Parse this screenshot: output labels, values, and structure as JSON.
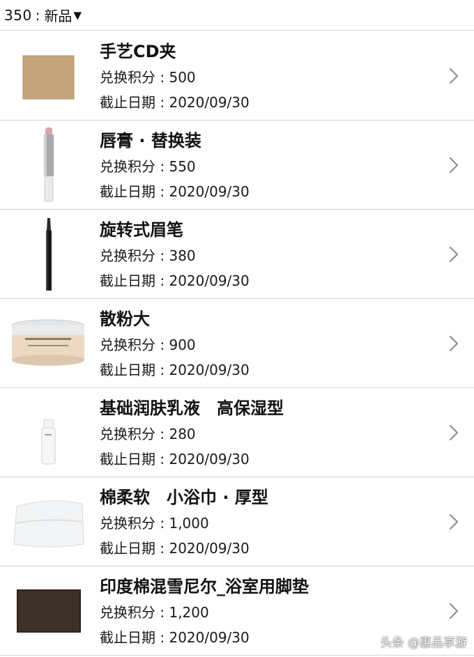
{
  "header": {
    "points": "350",
    "separator": ":",
    "filter_label": "新品",
    "caret": "▼"
  },
  "labels": {
    "points": "兑换积分",
    "deadline": "截止日期",
    "colon": ":"
  },
  "items": [
    {
      "name": "手艺CD夹",
      "points": "500",
      "deadline": "2020/09/30",
      "thumb": "cd-holder-image"
    },
    {
      "name": "唇膏 · 替换装",
      "points": "550",
      "deadline": "2020/09/30",
      "thumb": "lipstick-image"
    },
    {
      "name": "旋转式眉笔",
      "points": "380",
      "deadline": "2020/09/30",
      "thumb": "eyebrow-pencil-image"
    },
    {
      "name": "散粉大",
      "points": "900",
      "deadline": "2020/09/30",
      "thumb": "loose-powder-image"
    },
    {
      "name": "基础润肤乳液　高保湿型",
      "points": "280",
      "deadline": "2020/09/30",
      "thumb": "lotion-bottle-image"
    },
    {
      "name": "棉柔软　小浴巾 · 厚型",
      "points": "1,000",
      "deadline": "2020/09/30",
      "thumb": "towel-image"
    },
    {
      "name": "印度棉混雪尼尔_浴室用脚垫",
      "points": "1,200",
      "deadline": "2020/09/30",
      "thumb": "bath-mat-image"
    }
  ],
  "watermark": "头条 @惠品享游",
  "colors": {
    "divider": "#d4d4d4",
    "chevron": "#8e8e93",
    "text": "#111111"
  }
}
